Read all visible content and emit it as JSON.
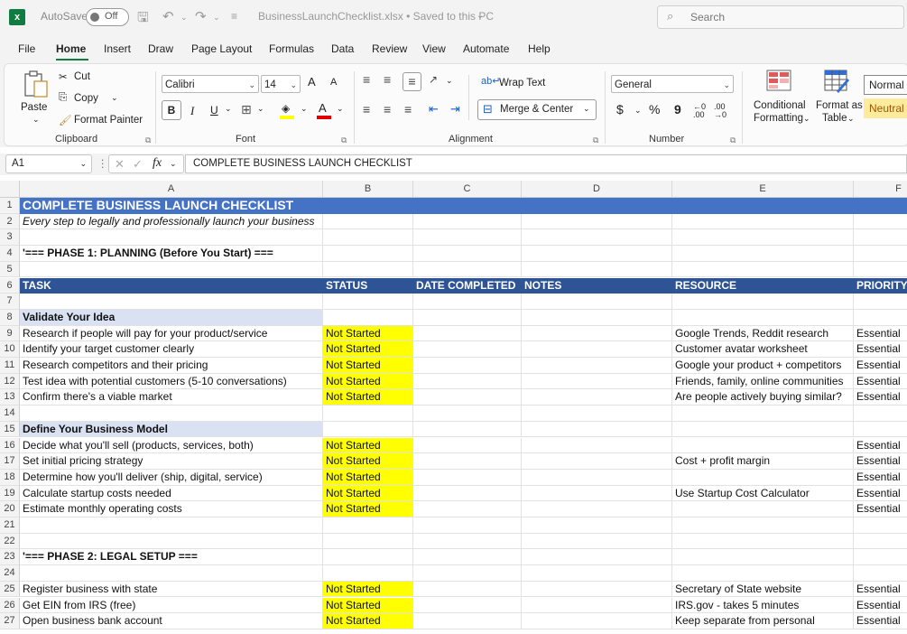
{
  "titlebar": {
    "autosave_label": "AutoSave",
    "autosave_state": "Off",
    "filename": "BusinessLaunchChecklist.xlsx • Saved to this PC",
    "search_placeholder": "Search"
  },
  "menu": {
    "items": [
      "File",
      "Home",
      "Insert",
      "Draw",
      "Page Layout",
      "Formulas",
      "Data",
      "Review",
      "View",
      "Automate",
      "Help"
    ],
    "active": "Home"
  },
  "ribbon": {
    "clipboard": {
      "paste": "Paste",
      "cut": "Cut",
      "copy": "Copy",
      "format_painter": "Format Painter",
      "label": "Clipboard"
    },
    "font": {
      "family": "Calibri",
      "size": "14",
      "bold": "B",
      "italic": "I",
      "underline": "U",
      "grow": "A",
      "shrink": "A",
      "label": "Font"
    },
    "alignment": {
      "wrap_text": "Wrap Text",
      "merge_center": "Merge & Center",
      "label": "Alignment"
    },
    "number": {
      "format": "General",
      "currency": "$",
      "percent": "%",
      "comma": "9",
      "inc_decimal": "←0 .00",
      "dec_decimal": ".00 →0",
      "label": "Number"
    },
    "styles": {
      "conditional_formatting_1": "Conditional",
      "conditional_formatting_2": "Formatting",
      "format_as_table_1": "Format as",
      "format_as_table_2": "Table",
      "normal": "Normal",
      "neutral": "Neutral"
    }
  },
  "formula_bar": {
    "name_box": "A1",
    "fx": "fx",
    "content": "COMPLETE BUSINESS LAUNCH CHECKLIST"
  },
  "columns": [
    "A",
    "B",
    "C",
    "D",
    "E",
    "F"
  ],
  "colors": {
    "excel_green": "#107c41",
    "title_blue": "#4472c4",
    "header_blue": "#2f5496",
    "section_blue": "#d9e1f2",
    "status_yellow": "#ffff00"
  },
  "rows": [
    {
      "n": "1",
      "type": "title",
      "a": "COMPLETE BUSINESS LAUNCH CHECKLIST"
    },
    {
      "n": "2",
      "type": "subtitle",
      "a": "Every step to legally and professionally launch your business"
    },
    {
      "n": "3",
      "type": "blank"
    },
    {
      "n": "4",
      "type": "phase",
      "a": "'=== PHASE 1: PLANNING (Before You Start) ==="
    },
    {
      "n": "5",
      "type": "blank"
    },
    {
      "n": "6",
      "type": "header",
      "a": "TASK",
      "b": "STATUS",
      "c": "DATE COMPLETED",
      "d": "NOTES",
      "e": "RESOURCE",
      "f": "PRIORITY"
    },
    {
      "n": "7",
      "type": "blank"
    },
    {
      "n": "8",
      "type": "section",
      "a": "Validate Your Idea"
    },
    {
      "n": "9",
      "type": "task",
      "a": "Research if people will pay for your product/service",
      "b": "Not Started",
      "e": "Google Trends, Reddit research",
      "f": "Essential"
    },
    {
      "n": "10",
      "type": "task",
      "a": "Identify your target customer clearly",
      "b": "Not Started",
      "e": "Customer avatar worksheet",
      "f": "Essential"
    },
    {
      "n": "11",
      "type": "task",
      "a": "Research competitors and their pricing",
      "b": "Not Started",
      "e": "Google your product + competitors",
      "f": "Essential"
    },
    {
      "n": "12",
      "type": "task",
      "a": "Test idea with potential customers (5-10 conversations)",
      "b": "Not Started",
      "e": "Friends, family, online communities",
      "f": "Essential"
    },
    {
      "n": "13",
      "type": "task",
      "a": "Confirm there's a viable market",
      "b": "Not Started",
      "e": "Are people actively buying similar?",
      "f": "Essential"
    },
    {
      "n": "14",
      "type": "blank"
    },
    {
      "n": "15",
      "type": "section",
      "a": "Define Your Business Model"
    },
    {
      "n": "16",
      "type": "task",
      "a": "Decide what you'll sell (products, services, both)",
      "b": "Not Started",
      "e": "",
      "f": "Essential"
    },
    {
      "n": "17",
      "type": "task",
      "a": "Set initial pricing strategy",
      "b": "Not Started",
      "e": "Cost + profit margin",
      "f": "Essential"
    },
    {
      "n": "18",
      "type": "task",
      "a": "Determine how you'll deliver (ship, digital, service)",
      "b": "Not Started",
      "e": "",
      "f": "Essential"
    },
    {
      "n": "19",
      "type": "task",
      "a": "Calculate startup costs needed",
      "b": "Not Started",
      "e": "Use Startup Cost Calculator",
      "f": "Essential"
    },
    {
      "n": "20",
      "type": "task",
      "a": "Estimate monthly operating costs",
      "b": "Not Started",
      "e": "",
      "f": "Essential"
    },
    {
      "n": "21",
      "type": "blank"
    },
    {
      "n": "22",
      "type": "blank"
    },
    {
      "n": "23",
      "type": "phase",
      "a": "'=== PHASE 2: LEGAL SETUP ==="
    },
    {
      "n": "24",
      "type": "blank"
    },
    {
      "n": "25",
      "type": "task",
      "a": "Register business with state",
      "b": "Not Started",
      "e": "Secretary of State website",
      "f": "Essential"
    },
    {
      "n": "26",
      "type": "task",
      "a": "Get EIN from IRS (free)",
      "b": "Not Started",
      "e": "IRS.gov - takes 5 minutes",
      "f": "Essential"
    },
    {
      "n": "27",
      "type": "task",
      "a": "Open business bank account",
      "b": "Not Started",
      "e": "Keep separate from personal",
      "f": "Essential"
    }
  ]
}
